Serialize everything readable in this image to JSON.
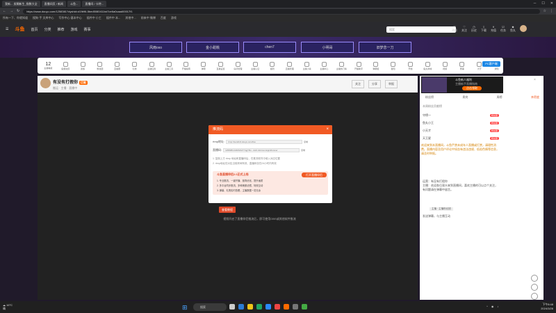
{
  "browser": {
    "tabs": [
      "我新... 卖糊新生_指数大全",
      "直播间页 / 新闻",
      "斗鱼...",
      "直播间 / 卡特..."
    ],
    "url": "https://www.douyu.com/1258381?dyshid=d1fb96-5bed5080411bd7ce6a0caad00017f1",
    "bookmarks": [
      "所有一下、你就知道",
      "搜狗·手 文库中心",
      "写作中心·基本中心",
      "插件中 小工",
      "插件中 本...",
      "其他中...",
      "前来中 微博",
      "百度",
      "游戏"
    ]
  },
  "site": {
    "logo": "斗鱼",
    "nav": [
      "首页",
      "分类",
      "推荐",
      "游戏",
      "赛事"
    ],
    "search_placeholder": "搜索",
    "header_icons": [
      "消息",
      "关注",
      "历史",
      "下载",
      "充值",
      "任务",
      "鱼丸"
    ]
  },
  "banner": {
    "buttons": [
      "风雨oxo",
      "金小甜桃",
      "chen7",
      "小明哥",
      "旧梦念一刀"
    ]
  },
  "toolbar": {
    "level": "12",
    "level_label": "主播等级",
    "items": [
      "鱼翅充值",
      "贵族",
      "粉丝团",
      "直播圈",
      "礼物",
      "主播任务",
      "主播工具",
      "开播指南",
      "弹幕",
      "直播设置",
      "房间管理",
      "主播认证",
      "超管",
      "直播管理",
      "主播小窝",
      "主播中心",
      "主播热门榜",
      "开播助手",
      "弹幕姬",
      "星知",
      "开始",
      "鱼丸商城",
      "视频",
      "赛事",
      "大厅",
      "通知"
    ],
    "pc_button": "PC客户端"
  },
  "room": {
    "title": "有没有打假你",
    "subtitle": "搬运 · 主播 · 直播中",
    "badge": "订阅",
    "follow": "关注",
    "share": "分享",
    "report": "举报"
  },
  "modal": {
    "title": "推流码",
    "rtmp_label": "rtmp地址:",
    "rtmp_value": "rtmp://sendtc3.douyu.com/live",
    "key_label": "直播码:",
    "key_value": "1258381rARZGNdYYqgYRo...dvdr-tsforcemsign&forever",
    "copy": "复制",
    "notes": [
      "1. 复制上方 rtmp 地址和直播码后，在推流软件中填入对应位置",
      "2. rtmp地址仅对应当前房间有效，直播码仅在24小时内有效"
    ],
    "promo_title": "斗鱼直播伴侣2.0正式上线",
    "promo_lines": [
      "1. 专业推流，一键开播、极简优化，提升画质",
      "2. 多平台同步推流，多种美颜滤镜，特效互动",
      "3. 弹幕、礼物实时查看，主播数据一览无余"
    ],
    "promo_button": "打开直播伴侣"
  },
  "video": {
    "check_button": "查看教程",
    "hint": "视频开启了直播伴侣推流后，即可使用OBS或其他软件推流"
  },
  "panel": {
    "ad_title": "斗鱼新人福利",
    "ad_sub": "主播新手直播指南",
    "ad_button": "点击领取",
    "tabs": [
      "粉丝榜",
      "贵宾",
      "周榜",
      "亲密度"
    ],
    "rank_header": "本周粉丝贡献榜",
    "ranks": [
      {
        "name": "守榜一",
        "badge": "粉丝团"
      },
      {
        "name": "鱼丸小王",
        "badge": "粉丝团"
      },
      {
        "name": "小天才",
        "badge": "粉丝团"
      },
      {
        "name": "天王星",
        "badge": "粉丝团"
      }
    ],
    "chat_notice": "欢迎来到本直播间，斗鱼严禁未成年人直播或打赏，请理性消费。直播内容及用户评论中如含有违法违规、低俗色情等信息，请及时举报。",
    "chat_user": "运营：有没有打假你",
    "chat_msg": "主播：欢迎各位观众来到直播间，喜欢主播的可以点个关注，有问题请在弹幕中留言。",
    "chat_tag": "主播 · 主播粉丝团",
    "chat_input": "发送弹幕，与主播互动"
  },
  "taskbar": {
    "weather_temp": "16°C",
    "weather_desc": "晴",
    "search": "搜索",
    "time": "下午8:48",
    "date": "2024/3/26"
  }
}
